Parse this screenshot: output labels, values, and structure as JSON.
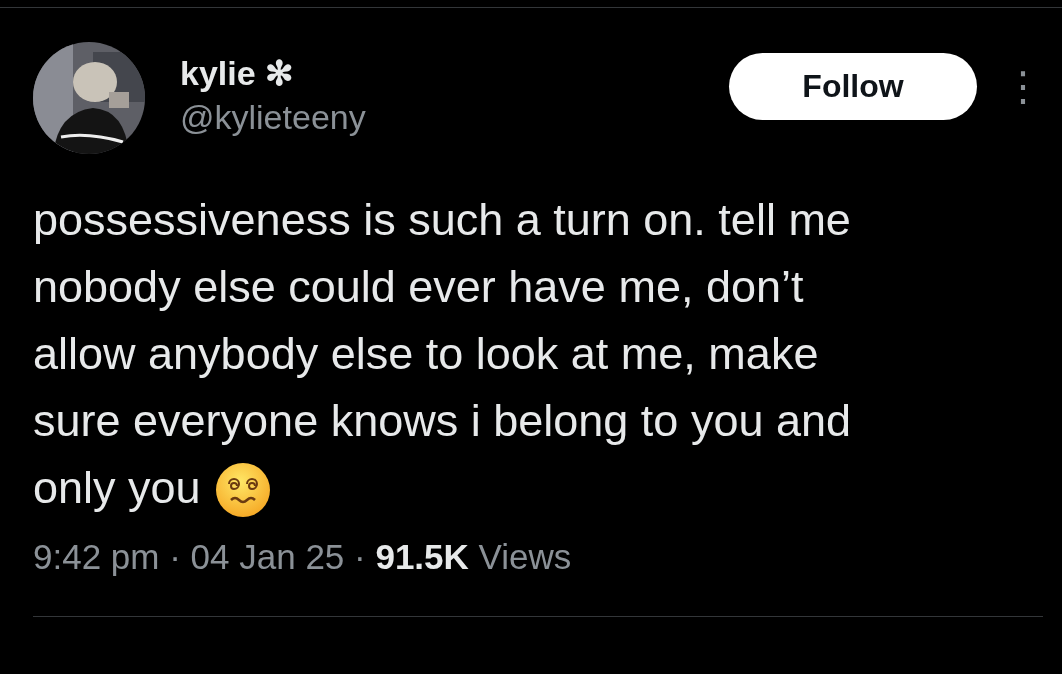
{
  "author": {
    "name": "kylie ✻",
    "handle": "@kylieteeny"
  },
  "follow_button": {
    "label": "Follow"
  },
  "more_button": {
    "label": "⋮"
  },
  "tweet": {
    "lines": [
      "possessiveness is such a turn on. tell me",
      "nobody else could ever have me, don’t",
      "allow anybody else to look at me, make",
      "sure everyone knows i belong to you and",
      "only you"
    ],
    "emoji": {
      "kind": "woozy-face"
    }
  },
  "meta": "9:42 pm · 04 Jan 25 · **91.5K** Views"
}
